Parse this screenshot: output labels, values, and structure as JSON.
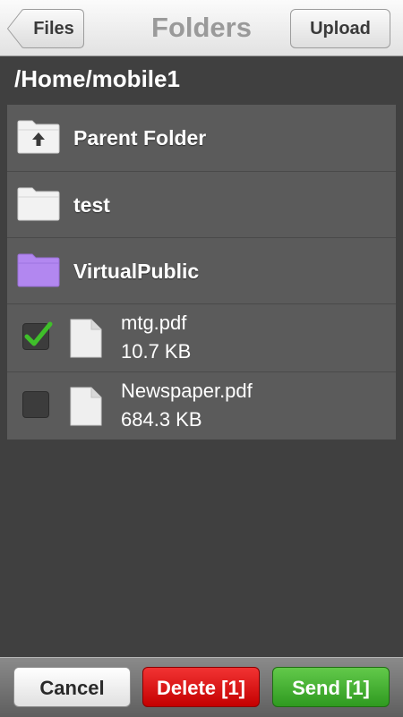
{
  "header": {
    "back_label": "Files",
    "title": "Folders",
    "upload_label": "Upload"
  },
  "path": "/Home/mobile1",
  "folders": [
    {
      "label": "Parent Folder",
      "icon": "folder-up-icon",
      "color": "#f2f2f2"
    },
    {
      "label": "test",
      "icon": "folder-icon",
      "color": "#f2f2f2"
    },
    {
      "label": "VirtualPublic",
      "icon": "folder-icon",
      "color": "#b287f0"
    }
  ],
  "files": [
    {
      "name": "mtg.pdf",
      "size": "10.7 KB",
      "checked": true
    },
    {
      "name": "Newspaper.pdf",
      "size": "684.3 KB",
      "checked": false
    }
  ],
  "footer": {
    "cancel_label": "Cancel",
    "delete_label": "Delete [1]",
    "send_label": "Send [1]"
  },
  "colors": {
    "delete": "#d90f0f",
    "send": "#45b22f",
    "checkmark": "#3fbf2a",
    "virtual_folder": "#b287f0"
  }
}
